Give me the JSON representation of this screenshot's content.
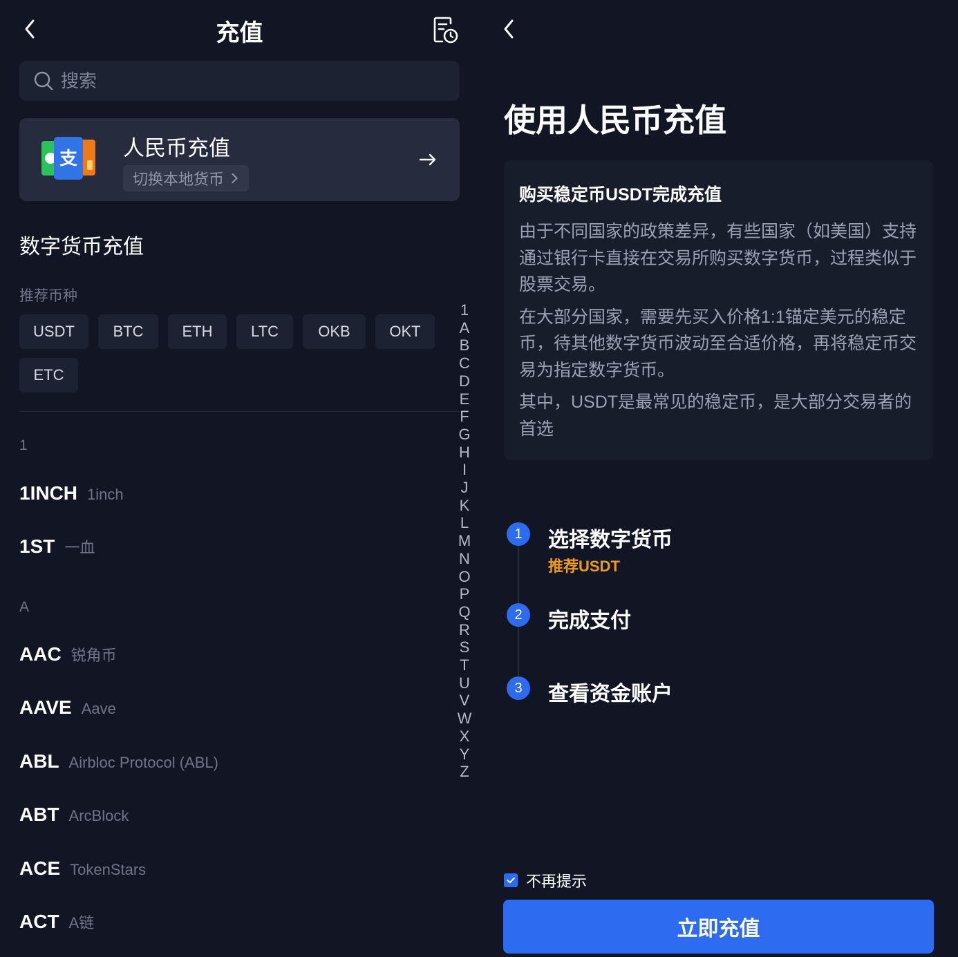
{
  "left": {
    "header": {
      "title": "充值"
    },
    "search": {
      "placeholder": "搜索"
    },
    "fiat_card": {
      "title": "人民币充值",
      "subtitle": "切换本地货币"
    },
    "section_title": "数字货币充值",
    "recommended_label": "推荐币种",
    "recommended_coins": [
      "USDT",
      "BTC",
      "ETH",
      "LTC",
      "OKB",
      "OKT",
      "ETC"
    ],
    "groups": [
      {
        "header": "1",
        "coins": [
          {
            "symbol": "1INCH",
            "name": "1inch"
          },
          {
            "symbol": "1ST",
            "name": "一血"
          }
        ]
      },
      {
        "header": "A",
        "coins": [
          {
            "symbol": "AAC",
            "name": "锐角币"
          },
          {
            "symbol": "AAVE",
            "name": "Aave"
          },
          {
            "symbol": "ABL",
            "name": "Airbloc Protocol (ABL)"
          },
          {
            "symbol": "ABT",
            "name": "ArcBlock"
          },
          {
            "symbol": "ACE",
            "name": "TokenStars"
          },
          {
            "symbol": "ACT",
            "name": "A链"
          }
        ]
      }
    ],
    "alpha_index": [
      "1",
      "A",
      "B",
      "C",
      "D",
      "E",
      "F",
      "G",
      "H",
      "I",
      "J",
      "K",
      "L",
      "M",
      "N",
      "O",
      "P",
      "Q",
      "R",
      "S",
      "T",
      "U",
      "V",
      "W",
      "X",
      "Y",
      "Z"
    ]
  },
  "right": {
    "title": "使用人民币充值",
    "info": {
      "heading": "购买稳定币USDT完成充值",
      "paragraphs": [
        "由于不同国家的政策差异，有些国家（如美国）支持通过银行卡直接在交易所购买数字货币，过程类似于股票交易。",
        "在大部分国家，需要先买入价格1:1锚定美元的稳定币，待其他数字货币波动至合适价格，再将稳定币交易为指定数字货币。",
        "其中，USDT是最常见的稳定币，是大部分交易者的首选"
      ]
    },
    "steps": [
      {
        "num": "1",
        "title": "选择数字货币",
        "sub": "推荐USDT"
      },
      {
        "num": "2",
        "title": "完成支付",
        "sub": ""
      },
      {
        "num": "3",
        "title": "查看资金账户",
        "sub": ""
      }
    ],
    "checkbox_label": "不再提示",
    "checkbox_checked": true,
    "button_label": "立即充值"
  },
  "colors": {
    "background": "#121624",
    "accent": "#2d6bf0",
    "highlight": "#f29a1c"
  }
}
